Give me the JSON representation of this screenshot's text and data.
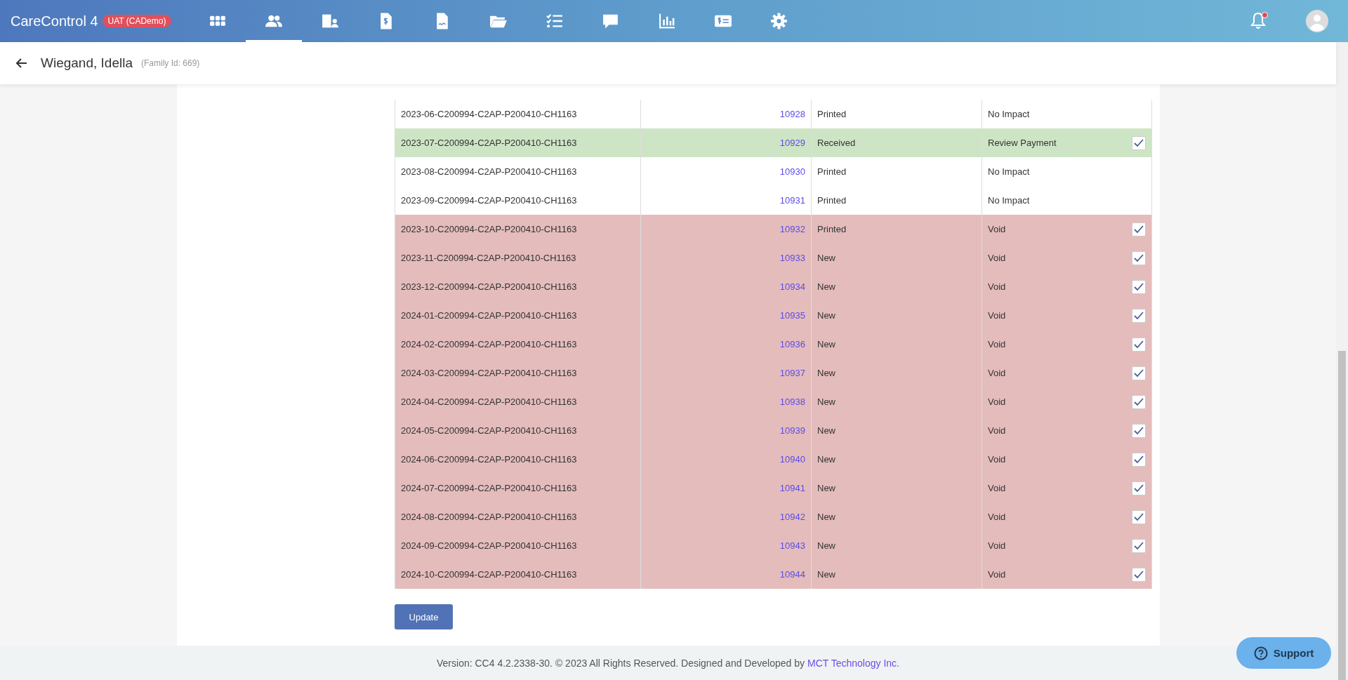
{
  "app": {
    "title": "CareControl 4",
    "env_badge": "UAT (CADemo)"
  },
  "nav": [
    {
      "kind": "apps",
      "selected": false
    },
    {
      "kind": "people",
      "selected": true
    },
    {
      "kind": "building",
      "selected": false
    },
    {
      "kind": "invoice",
      "selected": false
    },
    {
      "kind": "signed-doc",
      "selected": false
    },
    {
      "kind": "folder",
      "selected": false
    },
    {
      "kind": "checklist",
      "selected": false
    },
    {
      "kind": "chat",
      "selected": false
    },
    {
      "kind": "chart",
      "selected": false
    },
    {
      "kind": "payment",
      "selected": false
    },
    {
      "kind": "settings",
      "selected": false
    }
  ],
  "notifications": {
    "unread": true
  },
  "header": {
    "name": "Wiegand, Idella",
    "family_id": "(Family Id: 669)"
  },
  "table": {
    "rows": [
      {
        "period": "2023-06-C200994-C2AP-P200410-CH1163",
        "number": "10928",
        "status": "Printed",
        "action": "No Impact",
        "checked": false
      },
      {
        "period": "2023-07-C200994-C2AP-P200410-CH1163",
        "number": "10929",
        "status": "Received",
        "action": "Review Payment",
        "checked": true,
        "color": "#cde5c5"
      },
      {
        "period": "2023-08-C200994-C2AP-P200410-CH1163",
        "number": "10930",
        "status": "Printed",
        "action": "No Impact",
        "checked": false
      },
      {
        "period": "2023-09-C200994-C2AP-P200410-CH1163",
        "number": "10931",
        "status": "Printed",
        "action": "No Impact",
        "checked": false
      },
      {
        "period": "2023-10-C200994-C2AP-P200410-CH1163",
        "number": "10932",
        "status": "Printed",
        "action": "Void",
        "checked": true,
        "color": "#e4bcbc"
      },
      {
        "period": "2023-11-C200994-C2AP-P200410-CH1163",
        "number": "10933",
        "status": "New",
        "action": "Void",
        "checked": true,
        "color": "#e4bcbc"
      },
      {
        "period": "2023-12-C200994-C2AP-P200410-CH1163",
        "number": "10934",
        "status": "New",
        "action": "Void",
        "checked": true,
        "color": "#e4bcbc"
      },
      {
        "period": "2024-01-C200994-C2AP-P200410-CH1163",
        "number": "10935",
        "status": "New",
        "action": "Void",
        "checked": true,
        "color": "#e4bcbc"
      },
      {
        "period": "2024-02-C200994-C2AP-P200410-CH1163",
        "number": "10936",
        "status": "New",
        "action": "Void",
        "checked": true,
        "color": "#e4bcbc"
      },
      {
        "period": "2024-03-C200994-C2AP-P200410-CH1163",
        "number": "10937",
        "status": "New",
        "action": "Void",
        "checked": true,
        "color": "#e4bcbc"
      },
      {
        "period": "2024-04-C200994-C2AP-P200410-CH1163",
        "number": "10938",
        "status": "New",
        "action": "Void",
        "checked": true,
        "color": "#e4bcbc"
      },
      {
        "period": "2024-05-C200994-C2AP-P200410-CH1163",
        "number": "10939",
        "status": "New",
        "action": "Void",
        "checked": true,
        "color": "#e4bcbc"
      },
      {
        "period": "2024-06-C200994-C2AP-P200410-CH1163",
        "number": "10940",
        "status": "New",
        "action": "Void",
        "checked": true,
        "color": "#e4bcbc"
      },
      {
        "period": "2024-07-C200994-C2AP-P200410-CH1163",
        "number": "10941",
        "status": "New",
        "action": "Void",
        "checked": true,
        "color": "#e4bcbc"
      },
      {
        "period": "2024-08-C200994-C2AP-P200410-CH1163",
        "number": "10942",
        "status": "New",
        "action": "Void",
        "checked": true,
        "color": "#e4bcbc"
      },
      {
        "period": "2024-09-C200994-C2AP-P200410-CH1163",
        "number": "10943",
        "status": "New",
        "action": "Void",
        "checked": true,
        "color": "#e4bcbc"
      },
      {
        "period": "2024-10-C200994-C2AP-P200410-CH1163",
        "number": "10944",
        "status": "New",
        "action": "Void",
        "checked": true,
        "color": "#e4bcbc"
      }
    ]
  },
  "update_button": "Update",
  "footer": {
    "text": "Version: CC4 4.2.2338-30. © 2023 All Rights Reserved. Designed and Developed by",
    "link": "MCT Technology Inc."
  },
  "support_button": "Support"
}
